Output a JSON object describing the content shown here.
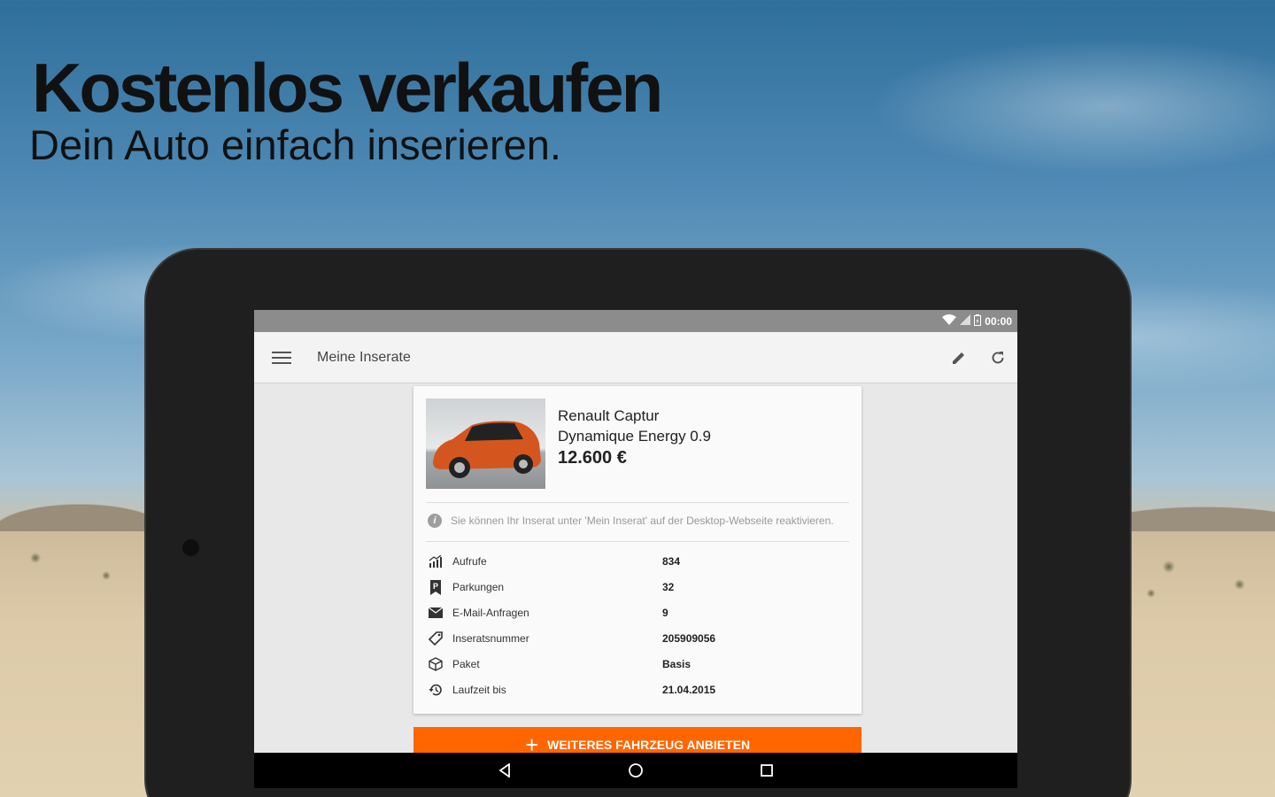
{
  "promo": {
    "headline": "Kostenlos verkaufen",
    "subline": "Dein Auto einfach inserieren."
  },
  "statusbar": {
    "time": "00:00",
    "icons": [
      "wifi-icon",
      "signal-icon",
      "battery-icon"
    ]
  },
  "appbar": {
    "title": "Meine Inserate",
    "icons": [
      "menu-icon",
      "edit-icon",
      "refresh-icon"
    ]
  },
  "listing": {
    "title_line1": "Renault Captur",
    "title_line2": "Dynamique Energy 0.9",
    "price": "12.600 €",
    "info": "Sie können Ihr Inserat unter 'Mein Inserat' auf der Desktop-Webseite reaktivieren.",
    "stats": [
      {
        "icon": "stats-icon",
        "label": "Aufrufe",
        "value": "834"
      },
      {
        "icon": "parking-icon",
        "label": "Parkungen",
        "value": "32"
      },
      {
        "icon": "mail-icon",
        "label": "E-Mail-Anfragen",
        "value": "9"
      },
      {
        "icon": "tag-icon",
        "label": "Inseratsnummer",
        "value": "205909056"
      },
      {
        "icon": "package-icon",
        "label": "Paket",
        "value": "Basis"
      },
      {
        "icon": "history-icon",
        "label": "Laufzeit bis",
        "value": "21.04.2015"
      }
    ]
  },
  "cta": {
    "label": "WEITERES FAHRZEUG ANBIETEN"
  },
  "colors": {
    "accent": "#ff6600",
    "appbar": "#f3f3f3",
    "statusbar": "#8c8c8c"
  }
}
